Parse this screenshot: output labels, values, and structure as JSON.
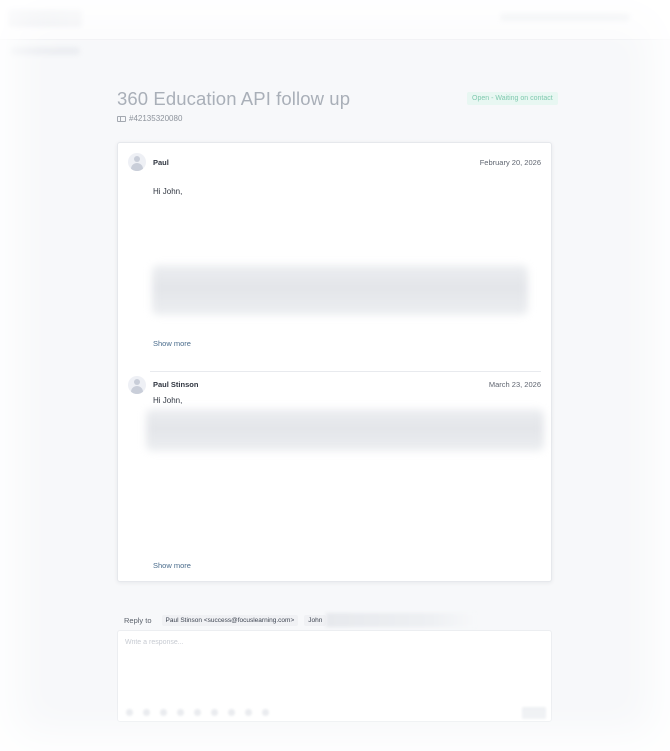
{
  "ticket": {
    "title": "360 Education API follow up",
    "status": "Open - Waiting on contact",
    "id": "#42135320080"
  },
  "messages": [
    {
      "sender": "Paul",
      "date": "February 20, 2026",
      "greeting": "Hi John,",
      "show_more": "Show more"
    },
    {
      "sender": "Paul Stinson",
      "date": "March 23, 2026",
      "greeting": "Hi John,",
      "show_more": "Show more"
    }
  ],
  "reply": {
    "label": "Reply to",
    "recipients": [
      "Paul Stinson <success@focuslearning.com>",
      "John"
    ],
    "placeholder": "Write a response..."
  },
  "colors": {
    "status_bg": "#e8f7f2",
    "status_text": "#7fc9ae",
    "link": "#4a6c8c"
  },
  "icons": [
    "ticket-icon",
    "avatar-icon"
  ]
}
